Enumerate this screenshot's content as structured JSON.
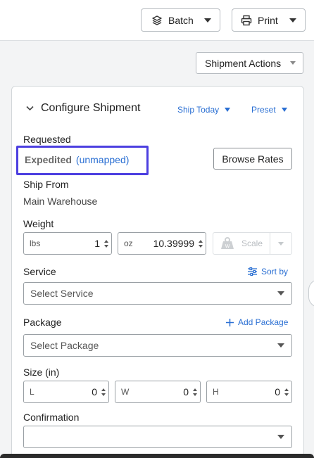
{
  "toolbar": {
    "batch_label": "Batch",
    "print_label": "Print",
    "shipment_actions_label": "Shipment Actions"
  },
  "configure": {
    "title": "Configure Shipment",
    "ship_today_label": "Ship Today",
    "preset_label": "Preset",
    "requested_label": "Requested",
    "requested_service": "Expedited",
    "requested_status": "(unmapped)",
    "browse_rates_label": "Browse Rates",
    "ship_from_label": "Ship From",
    "ship_from_value": "Main Warehouse",
    "weight_label": "Weight",
    "weight_lbs_unit": "lbs",
    "weight_lbs_value": "1",
    "weight_oz_unit": "oz",
    "weight_oz_value": "10.39999",
    "scale_label": "Scale",
    "service_label": "Service",
    "sort_by_label": "Sort by",
    "service_placeholder": "Select Service",
    "package_label": "Package",
    "add_package_label": "Add Package",
    "package_placeholder": "Select Package",
    "size_label": "Size (in)",
    "size_l_unit": "L",
    "size_l_value": "0",
    "size_w_unit": "W",
    "size_w_value": "0",
    "size_h_unit": "H",
    "size_h_value": "0",
    "confirmation_label": "Confirmation",
    "confirmation_value": ""
  },
  "colors": {
    "accent": "#2a6fd3",
    "highlight_box": "#4c3fe0"
  },
  "icons": {
    "batch": "layers-icon",
    "print": "printer-icon",
    "collapse": "chevron-down-icon",
    "scale": "weight-icon",
    "sort": "sliders-icon",
    "add": "plus-icon"
  }
}
